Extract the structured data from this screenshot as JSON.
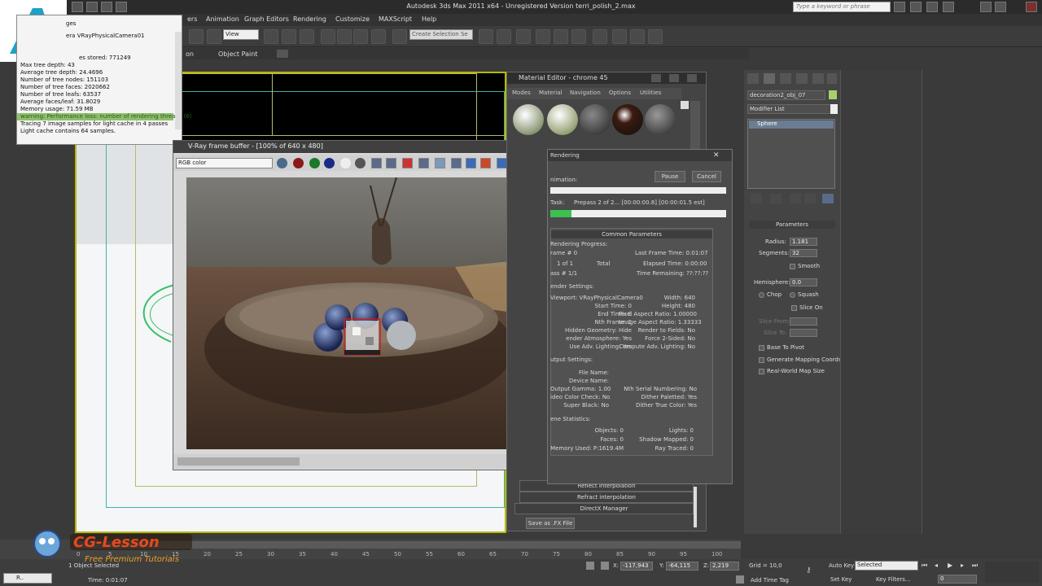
{
  "titlebar": {
    "title": "Autodesk 3ds Max  2011 x64  -  Unregistered Version   terri_polish_2.max",
    "search_placeholder": "Type a keyword or phrase"
  },
  "menu": [
    "ers",
    "Animation",
    "Graph Editors",
    "Rendering",
    "Customize",
    "MAXScript",
    "Help"
  ],
  "toolbar": {
    "view_dropdown": "View",
    "selection_set": "Create Selection Se"
  },
  "ribbon": {
    "left_label": "on",
    "object_paint": "Object Paint"
  },
  "log": {
    "top_partial": "ges",
    "camera_line": "era VRayPhysicalCamera01",
    "lines": [
      "es stored: 771249",
      "Max tree depth: 43",
      "Average tree depth: 24.4696",
      "Number of tree nodes: 151103",
      "Number of tree faces: 2020662",
      "Number of tree leafs: 63537",
      "Average faces/leaf: 31.8029",
      "Memory usage: 71.59 MB"
    ],
    "warning": "warning: Performance loss: number of rendering threads (6)",
    "tail": [
      "Tracing 7 image samples for light cache in 4 passes",
      "Light cache contains 64 samples."
    ]
  },
  "vfb": {
    "title": "V-Ray frame buffer - [100% of 640 x 480]",
    "channel": "RGB color"
  },
  "material_editor": {
    "title": "Material Editor - chrome 45",
    "menus": [
      "Modes",
      "Material",
      "Navigation",
      "Options",
      "Utilities"
    ],
    "rollouts": [
      "Reflect interpolation",
      "Refract interpolation",
      "DirectX Manager"
    ],
    "save_label": "Save as .FX File"
  },
  "render_progress": {
    "title": "Rendering",
    "animation_label": "nimation:",
    "pause": "Pause",
    "cancel": "Cancel",
    "task_label": "Task:",
    "task_text": "Prepass 2 of 2... [00:00:00.8] [00:00:01.5 est]",
    "progress": 0.12,
    "common_params": "Common Parameters",
    "rendering_progress": "Rendering Progress:",
    "frame": "rame #  0",
    "of_line": "1 of 1",
    "total": "Total",
    "pass": "ass #  1/1",
    "last_frame_time": "Last Frame Time:  0:01:07",
    "elapsed_time": "Elapsed Time:  0:00:00",
    "time_remaining": "Time Remaining:  ??:??:??",
    "render_settings": "ender Settings:",
    "settings_left": [
      "Viewport:  VRayPhysicalCamera0",
      "Start Time:  0",
      "End Time:  0",
      "Nth Frame:  1",
      "Hidden Geometry:  Hide",
      "ender Atmosphere:  Yes",
      "Use Adv. Lighting:  Yes"
    ],
    "settings_right": [
      "Width:  640",
      "Height:  480",
      "Pixel Aspect Ratio:  1.00000",
      "Image Aspect Ratio:  1.33333",
      "Render to Fields:  No",
      "Force 2-Sided:  No",
      "Compute Adv. Lighting:  No"
    ],
    "output_settings": "utput Settings:",
    "output_left": [
      "File Name:",
      "Device Name:",
      "Output Gamma:  1.00",
      "ideo Color Check:  No",
      "Super Black:  No"
    ],
    "output_right": [
      "Nth Serial Numbering:  No",
      "Dither Paletted:  Yes",
      "Dither True Color:  Yes"
    ],
    "scene_stats": "ene Statistics:",
    "stats_left": [
      "Objects:  0",
      "Faces:  0",
      "Memory Used:  P:1619.4M"
    ],
    "stats_right": [
      "Lights:  0",
      "Shadow Mapped:  0",
      "Ray Traced:  0"
    ]
  },
  "command_panel": {
    "object_name": "decoration2_obj_07",
    "modifier_list": "Modifier List",
    "stack_item": "Sphere",
    "parameters": "Parameters",
    "radius_label": "Radius:",
    "radius": "1.181",
    "segments_label": "Segments:",
    "segments": "32",
    "smooth": "Smooth",
    "hemisphere_label": "Hemisphere:",
    "hemisphere": "0.0",
    "chop": "Chop",
    "squash": "Squash",
    "slice_on": "Slice On",
    "slice_from": "Slice From:",
    "slice_to": "Slice To:",
    "base_to_pivot": "Base To Pivot",
    "gen_mapping": "Generate Mapping Coords",
    "real_world": "Real-World Map Size",
    "accent": "#a8d06a"
  },
  "timeline": {
    "ticks": [
      "0",
      "5",
      "10",
      "15",
      "20",
      "25",
      "30",
      "35",
      "40",
      "45",
      "50",
      "55",
      "60",
      "65",
      "70",
      "75",
      "80",
      "85",
      "90",
      "95",
      "100"
    ]
  },
  "status": {
    "selected_text": "1 Object Selected",
    "time": "Time: 0:01:07",
    "x_label": "X:",
    "x": "-117,943",
    "y_label": "Y:",
    "y": "-64,115",
    "z_label": "Z:",
    "z": "2,219",
    "grid": "Grid = 10,0",
    "add_time_tag": "Add Time Tag",
    "auto_key": "Auto Key",
    "set_key": "Set Key",
    "key_mode": "Selected",
    "key_filters": "Key Filters...",
    "frame": "0",
    "taskbar_item": "R.."
  },
  "branding": {
    "name": "CG-Lesson",
    "tagline": "Free Premium Tutorials"
  }
}
